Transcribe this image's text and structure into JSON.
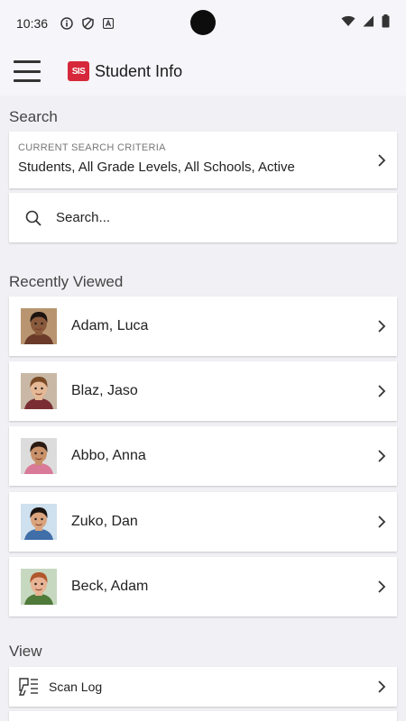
{
  "status_bar": {
    "time": "10:36"
  },
  "app_bar": {
    "logo_text": "SIS",
    "title": "Student Info"
  },
  "search_section": {
    "label": "Search",
    "criteria_caption": "CURRENT SEARCH CRITERIA",
    "criteria_value": "Students, All Grade Levels, All Schools, Active",
    "search_placeholder": "Search..."
  },
  "recent_section": {
    "label": "Recently Viewed",
    "students": [
      {
        "name": "Adam, Luca",
        "skin": "#8a5a3c",
        "hair": "#1e1410",
        "shirt": "#6b3b2a",
        "bg": "#b89570"
      },
      {
        "name": "Blaz, Jaso",
        "skin": "#e5b896",
        "hair": "#7a4a26",
        "shirt": "#7a2e34",
        "bg": "#c9b8a6"
      },
      {
        "name": "Abbo, Anna",
        "skin": "#c9916a",
        "hair": "#2a1a12",
        "shirt": "#d97a98",
        "bg": "#dcdcdc"
      },
      {
        "name": "Zuko, Dan",
        "skin": "#d9a47e",
        "hair": "#1a1410",
        "shirt": "#3f6ea8",
        "bg": "#cfe0ee"
      },
      {
        "name": "Beck, Adam",
        "skin": "#e8b394",
        "hair": "#b0582c",
        "shirt": "#4f7a3a",
        "bg": "#c7d8c0"
      }
    ]
  },
  "view_section": {
    "label": "View",
    "items": [
      {
        "label": "Scan Log",
        "icon": "scan-log-icon"
      }
    ]
  },
  "colors": {
    "brand": "#d6283a",
    "background": "#f1f1f5"
  }
}
